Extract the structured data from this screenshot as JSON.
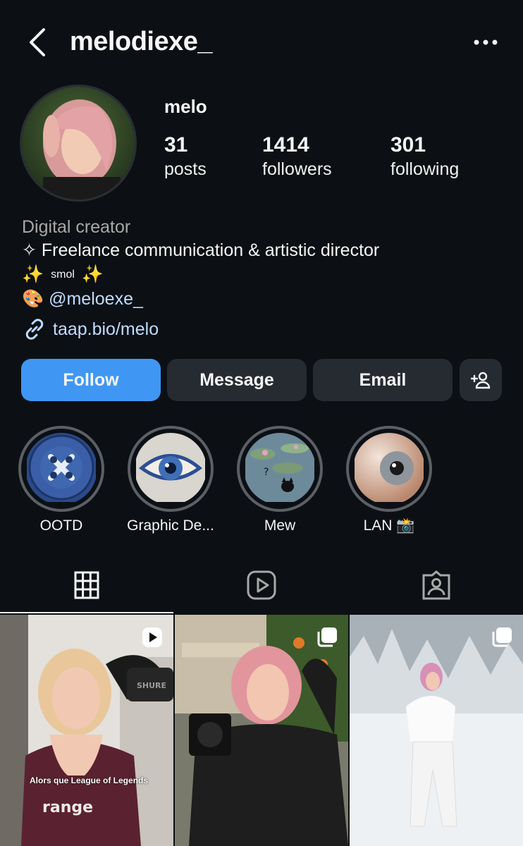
{
  "header": {
    "username": "melodiexe_",
    "back_icon": "chevron-left-icon",
    "more_icon": "more-horizontal-icon"
  },
  "profile": {
    "display_name": "melo",
    "stats": [
      {
        "value": "31",
        "label": "posts"
      },
      {
        "value": "1414",
        "label": "followers"
      },
      {
        "value": "301",
        "label": "following"
      }
    ]
  },
  "bio": {
    "category": "Digital creator",
    "line1": "✧ Freelance communication & artistic director",
    "line2_emoji_left": "✨",
    "line2_text": "smol",
    "line2_emoji_right": "✨",
    "line3_emoji": "🎨",
    "line3_mention": "@meloexe_",
    "link_icon": "link-icon",
    "link": "taap.bio/melo"
  },
  "actions": {
    "follow": "Follow",
    "message": "Message",
    "email": "Email",
    "add_person_icon": "add-person-icon"
  },
  "highlights": [
    {
      "label": "OOTD"
    },
    {
      "label": "Graphic De..."
    },
    {
      "label": "Mew"
    },
    {
      "label": "LAN 📸"
    }
  ],
  "tabs": [
    {
      "icon": "grid-icon",
      "active": true
    },
    {
      "icon": "reels-icon",
      "active": false
    },
    {
      "icon": "tagged-icon",
      "active": false
    }
  ],
  "posts": [
    {
      "type": "reel",
      "caption": "Alors que League of Legends"
    },
    {
      "type": "carousel",
      "caption": ""
    },
    {
      "type": "carousel",
      "caption": ""
    }
  ],
  "colors": {
    "background": "#0c1014",
    "primary_button": "#3f97f3",
    "secondary_button": "#262a31",
    "link": "#bfdcff",
    "muted_text": "#a8a8a8"
  }
}
